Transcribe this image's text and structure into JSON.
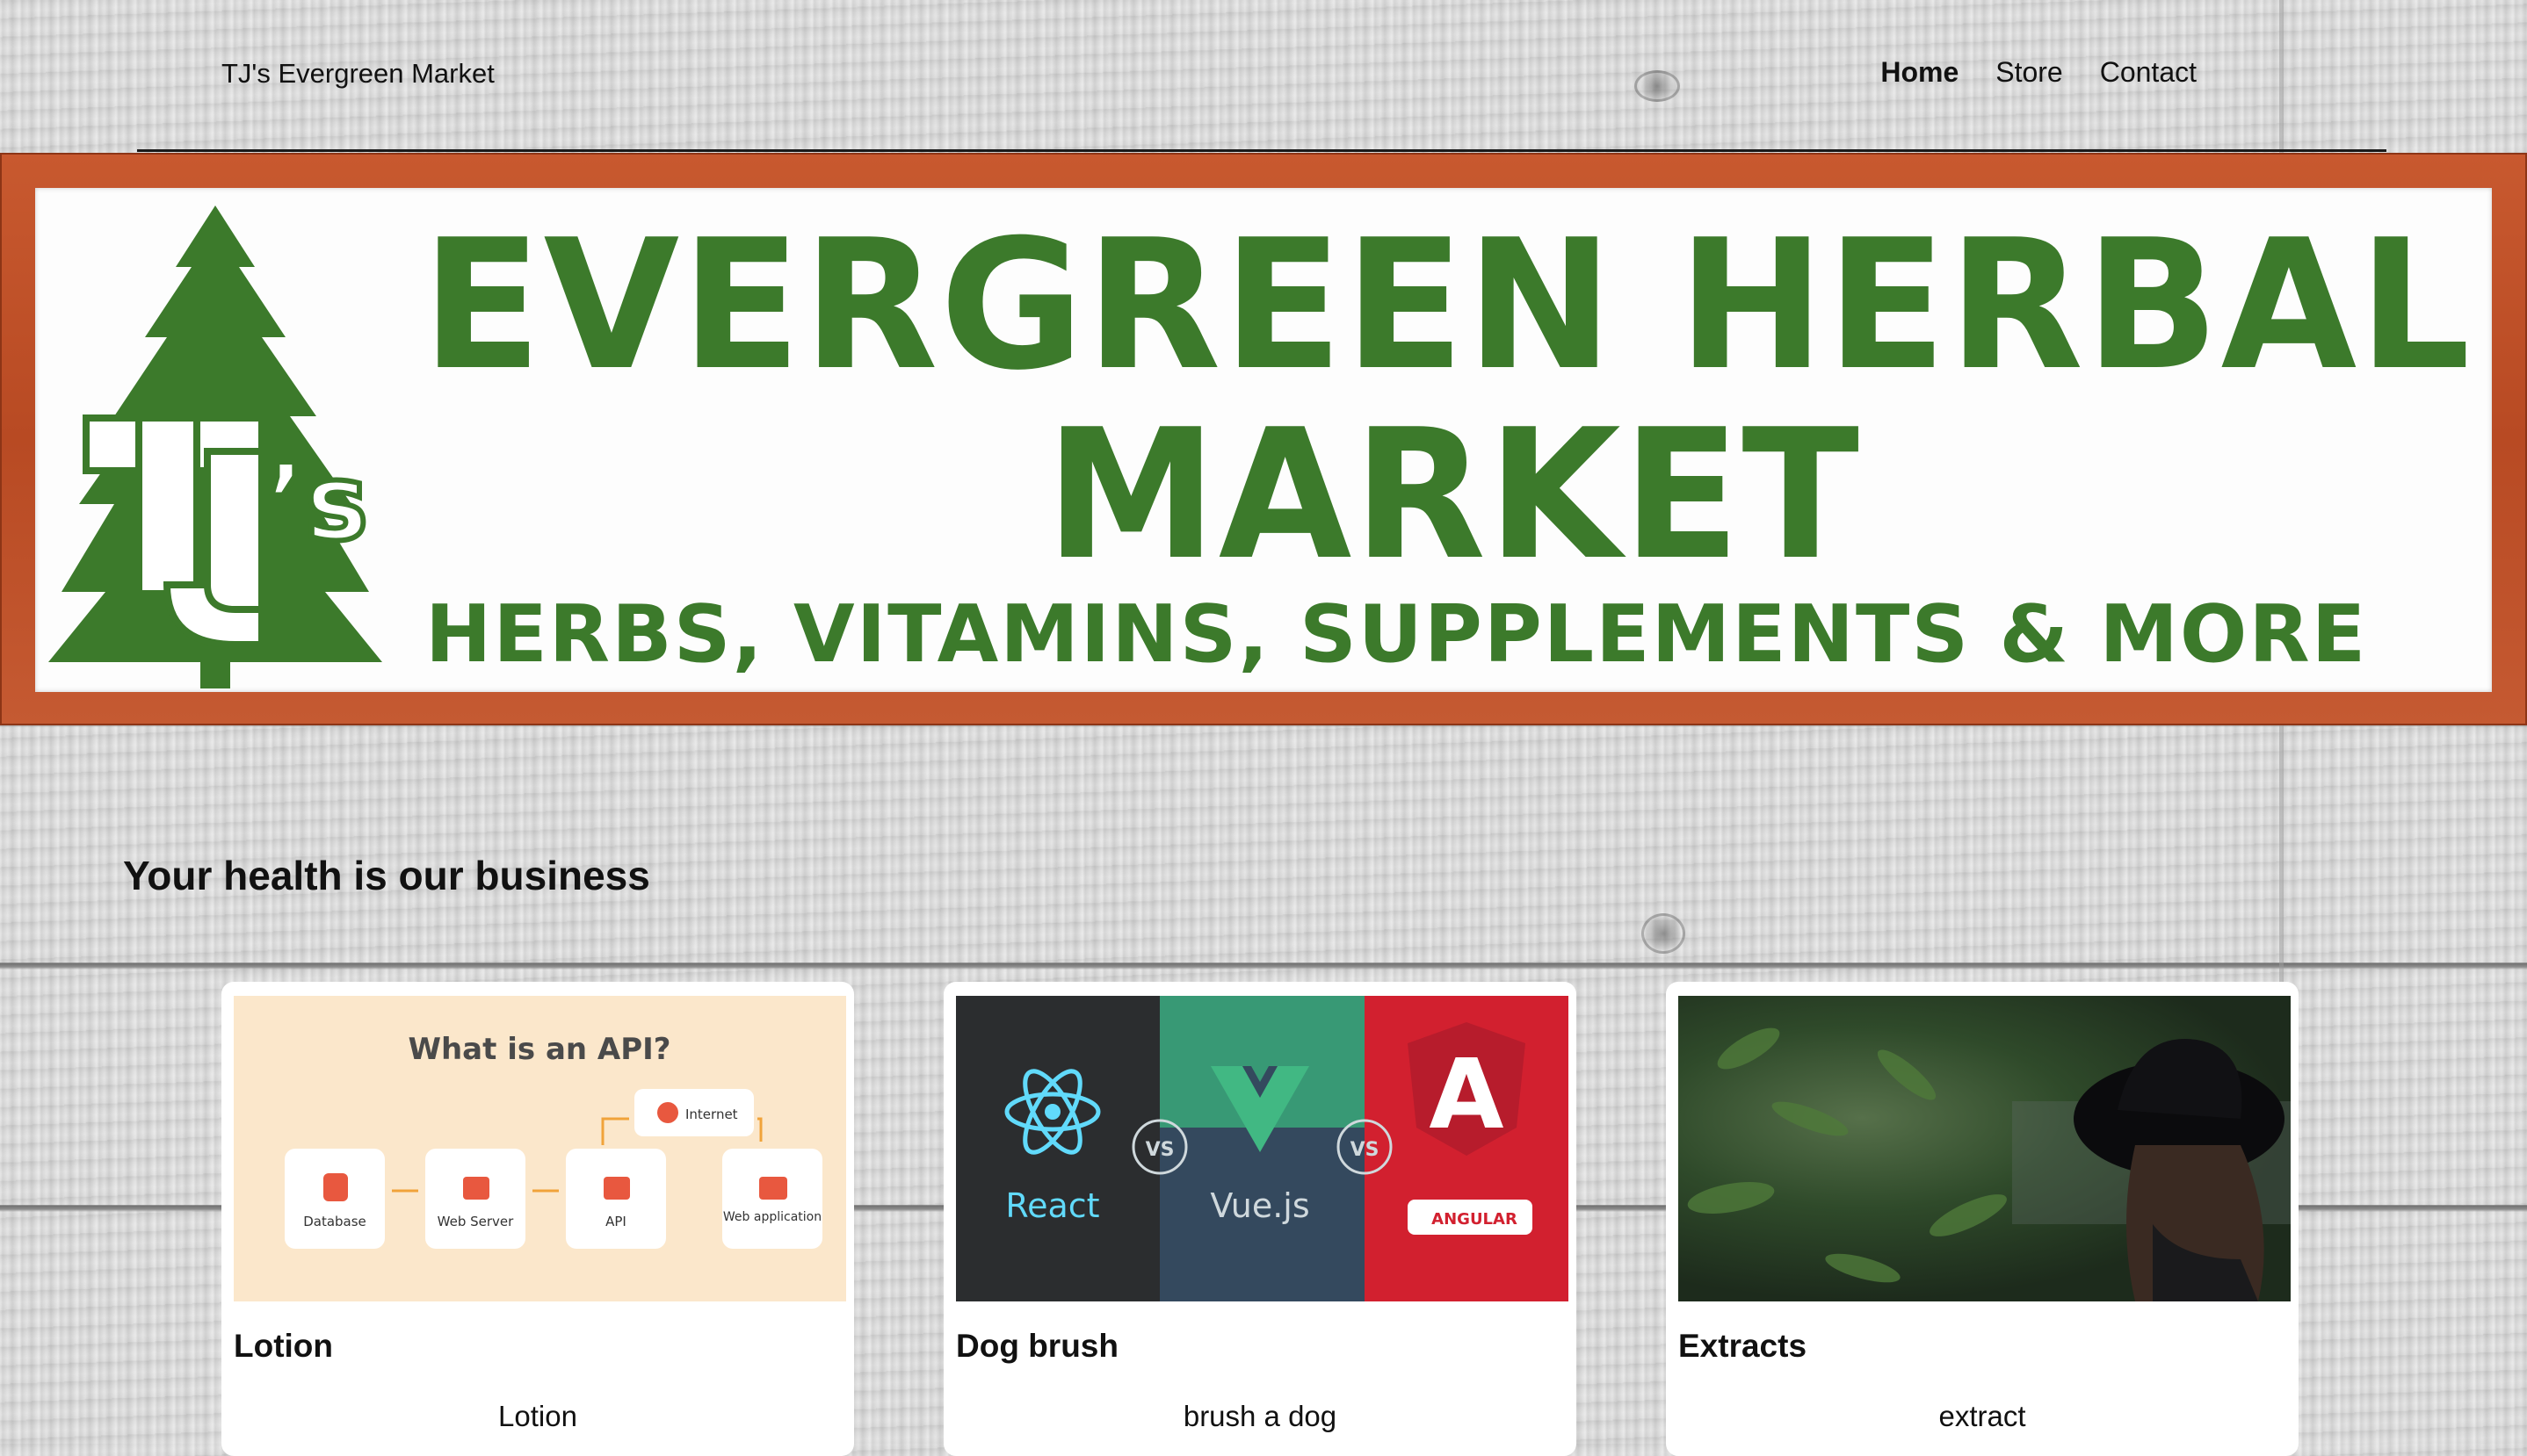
{
  "header": {
    "brand": "TJ's Evergreen Market",
    "nav": [
      {
        "label": "Home",
        "active": true
      },
      {
        "label": "Store",
        "active": false
      },
      {
        "label": "Contact",
        "active": false
      }
    ]
  },
  "banner": {
    "logo_text": "TJ's",
    "line1": "EVERGREEN  HERBAL",
    "line2": "MARKET",
    "line3": "HERBS, VITAMINS, SUPPLEMENTS & MORE",
    "colors": {
      "frame": "#c4572e",
      "text": "#3c7a2b"
    }
  },
  "main": {
    "headline": "Your health is our business"
  },
  "cards": [
    {
      "title": "Lotion",
      "description": "Lotion",
      "image": {
        "heading": "What is an API?",
        "nodes": [
          "Database",
          "Web Server",
          "API",
          "Web application"
        ],
        "top_node": "Internet"
      }
    },
    {
      "title": "Dog brush",
      "description": "brush a dog",
      "image": {
        "panels": [
          "React",
          "Vue.js",
          "ANGULAR"
        ],
        "vs": "VS"
      }
    },
    {
      "title": "Extracts",
      "description": "extract",
      "image": {
        "subject": "person-in-black-hat-photo"
      }
    }
  ]
}
